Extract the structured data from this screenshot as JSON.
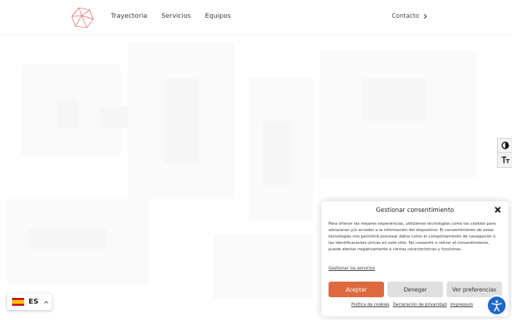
{
  "header": {
    "nav": [
      "Trayectoria",
      "Servicios",
      "Equipos"
    ],
    "contact_label": "Contacto"
  },
  "language": {
    "code": "ES"
  },
  "consent": {
    "title": "Gestionar consentimiento",
    "body": "Para ofrecer las mejores experiencias, utilizamos tecnologías como las cookies para almacenar y/o acceder a la información del dispositivo. El consentimiento de estas tecnologías nos permitirá procesar datos como el comportamiento de navegación o las identificaciones únicas en este sitio. No consentir o retirar el consentimiento, puede afectar negativamente a ciertas características y funciones.",
    "manage_link": "Gestionar los servicios",
    "accept": "Aceptar",
    "deny": "Denegar",
    "preferences": "Ver preferencias",
    "links": [
      "Política de cookies",
      "Declaración de privacidad",
      "Impressum"
    ]
  },
  "colors": {
    "accent": "#dd6a3f",
    "logo": "#e06c6c",
    "a11y_blue": "#1d67c9"
  },
  "icons": {
    "logo": "polyhedron-logo",
    "contact": "chevron-right-icon",
    "contrast": "contrast-icon",
    "text_size": "text-size-icon",
    "close": "close-icon",
    "flag": "spain-flag-icon",
    "accessibility": "accessibility-icon"
  }
}
